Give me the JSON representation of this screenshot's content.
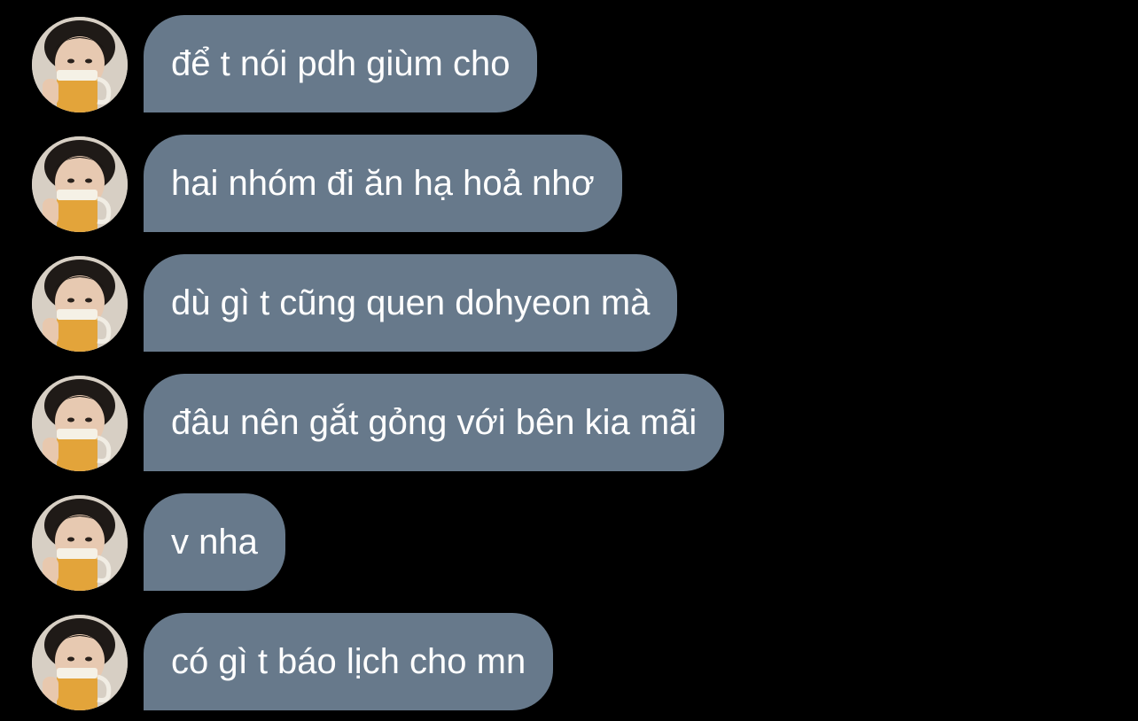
{
  "colors": {
    "background": "#000000",
    "bubble": "#67798b",
    "text": "#ffffff"
  },
  "messages": [
    {
      "text": "để t nói pdh giùm cho",
      "avatar": "profile-photo"
    },
    {
      "text": "hai nhóm đi ăn hạ hoả nhơ",
      "avatar": "profile-photo"
    },
    {
      "text": "dù gì t cũng quen dohyeon mà",
      "avatar": "profile-photo"
    },
    {
      "text": "đâu nên gắt gỏng với bên kia mãi",
      "avatar": "profile-photo"
    },
    {
      "text": "v nha",
      "avatar": "profile-photo"
    },
    {
      "text": "có gì t báo lịch cho mn",
      "avatar": "profile-photo"
    }
  ]
}
